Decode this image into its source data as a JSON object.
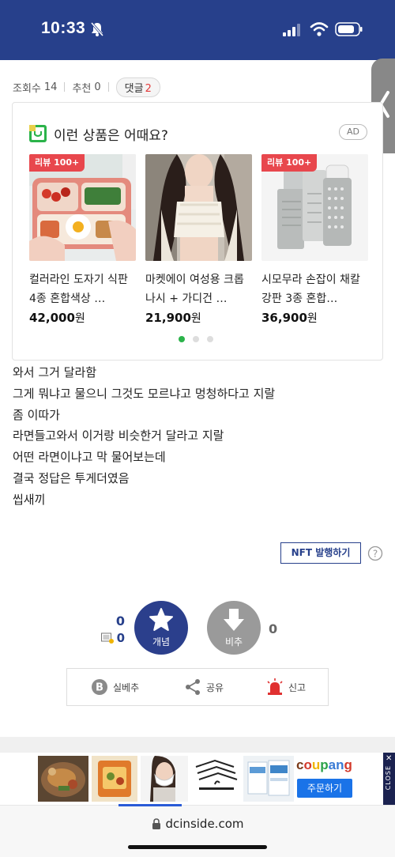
{
  "status": {
    "time": "10:33"
  },
  "stats": {
    "views_label": "조회수",
    "views": "14",
    "recommend_label": "추천",
    "recommend": "0",
    "comment_label": "댓글",
    "comment_count": "2"
  },
  "ad": {
    "title": "이런 상품은 어때요?",
    "badge": "AD",
    "products": [
      {
        "tag": "리뷰 100+",
        "name": "컬러라인 도자기 식판 4종 혼합색상 …",
        "price": "42,000",
        "currency": "원"
      },
      {
        "tag": "",
        "name": "마켓에이 여성용 크롭 나시 + 가디건 …",
        "price": "21,900",
        "currency": "원"
      },
      {
        "tag": "리뷰 100+",
        "name": "시모무라 손잡이 채칼 강판 3종 혼합…",
        "price": "36,900",
        "currency": "원"
      }
    ]
  },
  "post": {
    "lines": [
      "와서 그거 달라함",
      "그게 뭐냐고 물으니 그것도 모르냐고 멍청하다고 지랄",
      "좀 이따가",
      "라면들고와서 이거랑 비슷한거 달라고 지랄",
      "어떤 라면이냐고 막 물어보는데",
      "결국 정답은 투게더였음",
      "씹새끼"
    ]
  },
  "nft": {
    "label": "NFT 발행하기"
  },
  "vote": {
    "up_count": "0",
    "fix_count": "0",
    "up_label": "개념",
    "down_label": "비추",
    "down_count": "0"
  },
  "actions": {
    "best": "실베추",
    "share": "공유",
    "report": "신고"
  },
  "banner": {
    "brand": "coupang",
    "order": "주문하기",
    "close": "CLOSE"
  },
  "browser": {
    "url": "dcinside.com"
  },
  "colors": {
    "header": "#27408b",
    "recommend": "#2b3f8c",
    "tag": "#e8474d",
    "order": "#1a73e8"
  }
}
